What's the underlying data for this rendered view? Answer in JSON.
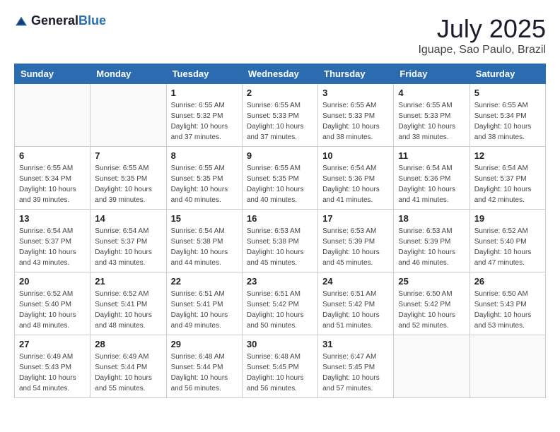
{
  "logo": {
    "general": "General",
    "blue": "Blue"
  },
  "title": "July 2025",
  "subtitle": "Iguape, Sao Paulo, Brazil",
  "weekdays": [
    "Sunday",
    "Monday",
    "Tuesday",
    "Wednesday",
    "Thursday",
    "Friday",
    "Saturday"
  ],
  "weeks": [
    [
      {
        "day": "",
        "info": ""
      },
      {
        "day": "",
        "info": ""
      },
      {
        "day": "1",
        "info": "Sunrise: 6:55 AM\nSunset: 5:32 PM\nDaylight: 10 hours and 37 minutes."
      },
      {
        "day": "2",
        "info": "Sunrise: 6:55 AM\nSunset: 5:33 PM\nDaylight: 10 hours and 37 minutes."
      },
      {
        "day": "3",
        "info": "Sunrise: 6:55 AM\nSunset: 5:33 PM\nDaylight: 10 hours and 38 minutes."
      },
      {
        "day": "4",
        "info": "Sunrise: 6:55 AM\nSunset: 5:33 PM\nDaylight: 10 hours and 38 minutes."
      },
      {
        "day": "5",
        "info": "Sunrise: 6:55 AM\nSunset: 5:34 PM\nDaylight: 10 hours and 38 minutes."
      }
    ],
    [
      {
        "day": "6",
        "info": "Sunrise: 6:55 AM\nSunset: 5:34 PM\nDaylight: 10 hours and 39 minutes."
      },
      {
        "day": "7",
        "info": "Sunrise: 6:55 AM\nSunset: 5:35 PM\nDaylight: 10 hours and 39 minutes."
      },
      {
        "day": "8",
        "info": "Sunrise: 6:55 AM\nSunset: 5:35 PM\nDaylight: 10 hours and 40 minutes."
      },
      {
        "day": "9",
        "info": "Sunrise: 6:55 AM\nSunset: 5:35 PM\nDaylight: 10 hours and 40 minutes."
      },
      {
        "day": "10",
        "info": "Sunrise: 6:54 AM\nSunset: 5:36 PM\nDaylight: 10 hours and 41 minutes."
      },
      {
        "day": "11",
        "info": "Sunrise: 6:54 AM\nSunset: 5:36 PM\nDaylight: 10 hours and 41 minutes."
      },
      {
        "day": "12",
        "info": "Sunrise: 6:54 AM\nSunset: 5:37 PM\nDaylight: 10 hours and 42 minutes."
      }
    ],
    [
      {
        "day": "13",
        "info": "Sunrise: 6:54 AM\nSunset: 5:37 PM\nDaylight: 10 hours and 43 minutes."
      },
      {
        "day": "14",
        "info": "Sunrise: 6:54 AM\nSunset: 5:37 PM\nDaylight: 10 hours and 43 minutes."
      },
      {
        "day": "15",
        "info": "Sunrise: 6:54 AM\nSunset: 5:38 PM\nDaylight: 10 hours and 44 minutes."
      },
      {
        "day": "16",
        "info": "Sunrise: 6:53 AM\nSunset: 5:38 PM\nDaylight: 10 hours and 45 minutes."
      },
      {
        "day": "17",
        "info": "Sunrise: 6:53 AM\nSunset: 5:39 PM\nDaylight: 10 hours and 45 minutes."
      },
      {
        "day": "18",
        "info": "Sunrise: 6:53 AM\nSunset: 5:39 PM\nDaylight: 10 hours and 46 minutes."
      },
      {
        "day": "19",
        "info": "Sunrise: 6:52 AM\nSunset: 5:40 PM\nDaylight: 10 hours and 47 minutes."
      }
    ],
    [
      {
        "day": "20",
        "info": "Sunrise: 6:52 AM\nSunset: 5:40 PM\nDaylight: 10 hours and 48 minutes."
      },
      {
        "day": "21",
        "info": "Sunrise: 6:52 AM\nSunset: 5:41 PM\nDaylight: 10 hours and 48 minutes."
      },
      {
        "day": "22",
        "info": "Sunrise: 6:51 AM\nSunset: 5:41 PM\nDaylight: 10 hours and 49 minutes."
      },
      {
        "day": "23",
        "info": "Sunrise: 6:51 AM\nSunset: 5:42 PM\nDaylight: 10 hours and 50 minutes."
      },
      {
        "day": "24",
        "info": "Sunrise: 6:51 AM\nSunset: 5:42 PM\nDaylight: 10 hours and 51 minutes."
      },
      {
        "day": "25",
        "info": "Sunrise: 6:50 AM\nSunset: 5:42 PM\nDaylight: 10 hours and 52 minutes."
      },
      {
        "day": "26",
        "info": "Sunrise: 6:50 AM\nSunset: 5:43 PM\nDaylight: 10 hours and 53 minutes."
      }
    ],
    [
      {
        "day": "27",
        "info": "Sunrise: 6:49 AM\nSunset: 5:43 PM\nDaylight: 10 hours and 54 minutes."
      },
      {
        "day": "28",
        "info": "Sunrise: 6:49 AM\nSunset: 5:44 PM\nDaylight: 10 hours and 55 minutes."
      },
      {
        "day": "29",
        "info": "Sunrise: 6:48 AM\nSunset: 5:44 PM\nDaylight: 10 hours and 56 minutes."
      },
      {
        "day": "30",
        "info": "Sunrise: 6:48 AM\nSunset: 5:45 PM\nDaylight: 10 hours and 56 minutes."
      },
      {
        "day": "31",
        "info": "Sunrise: 6:47 AM\nSunset: 5:45 PM\nDaylight: 10 hours and 57 minutes."
      },
      {
        "day": "",
        "info": ""
      },
      {
        "day": "",
        "info": ""
      }
    ]
  ]
}
